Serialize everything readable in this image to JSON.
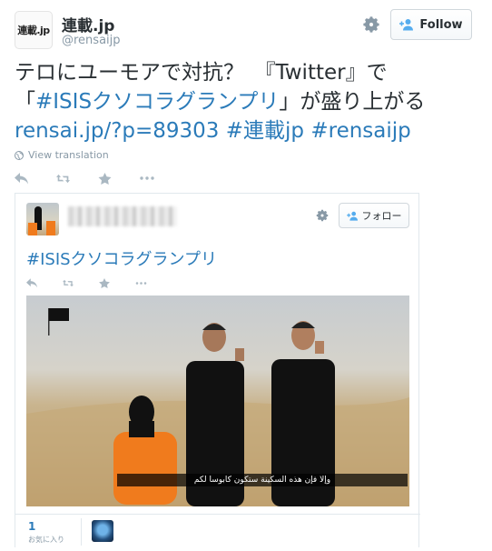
{
  "author": {
    "avatar_text": "連載.jp",
    "name": "連載.jp",
    "handle": "@rensaijp",
    "follow_label": "Follow"
  },
  "tweet": {
    "line1": "テロにユーモアで対抗？　『Twitter』で",
    "line2_prefix": "「",
    "line2_hashtag": "#ISISクソコラグランプリ",
    "line2_suffix": "」が盛り上がる",
    "link_url": "rensai.jp/?p=89303",
    "link_hashtag1": "#連載jp",
    "link_hashtag2": "#rensaijp",
    "view_translation": "View translation"
  },
  "icons": {
    "gear": "gear-icon",
    "follow": "person-plus-icon",
    "reply": "reply-icon",
    "retweet": "retweet-icon",
    "favorite": "star-icon",
    "more": "more-dots-icon",
    "globe": "globe-icon"
  },
  "embedded": {
    "follow_label": "フォロー",
    "hashtag": "#ISISクソコラグランプリ",
    "photo_caption": "وإلا فإن هذه السكينة ستكون كابوسا لكم",
    "favorites_count": "1",
    "favorites_label": "お気に入り"
  },
  "colors": {
    "link": "#2b7bb9",
    "muted": "#8899a6",
    "text": "#292f33",
    "jumpsuit": "#f07b1d"
  }
}
